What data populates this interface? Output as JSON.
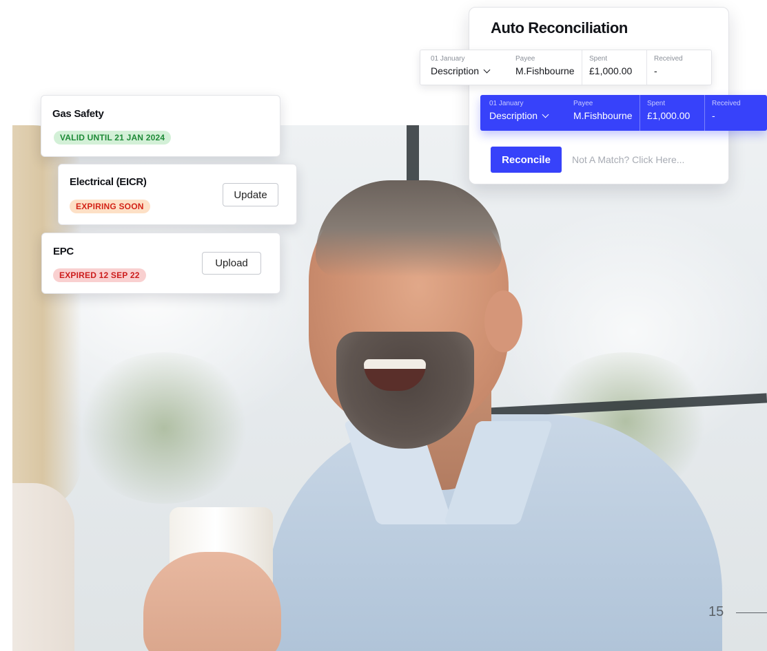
{
  "compliance_cards": [
    {
      "title": "Gas Safety",
      "status": "VALID UNTIL 21 JAN 2024",
      "status_color": "#1e8a37"
    },
    {
      "title": "Electrical (EICR)",
      "status": "EXPIRING SOON",
      "status_color": "#d32317",
      "action_label": "Update"
    },
    {
      "title": "EPC",
      "status": "EXPIRED 12 SEP 22",
      "status_color": "#cc1c1c",
      "action_label": "Upload"
    }
  ],
  "reconciliation": {
    "title": "Auto Reconciliation",
    "rows": [
      {
        "date": "01 January",
        "description": "Description",
        "payee_label": "Payee",
        "payee": "M.Fishbourne",
        "spent_label": "Spent",
        "spent": "£1,000.00",
        "received_label": "Received",
        "received": "-"
      },
      {
        "date": "01 January",
        "description": "Description",
        "payee_label": "Payee",
        "payee": "M.Fishbourne",
        "spent_label": "Spent",
        "spent": "£1,000.00",
        "received_label": "Received",
        "received": "-"
      }
    ],
    "reconcile_label": "Reconcile",
    "not_match_label": "Not A Match? Click Here...",
    "accent_color": "#3742fa"
  },
  "page": {
    "number": "15"
  }
}
